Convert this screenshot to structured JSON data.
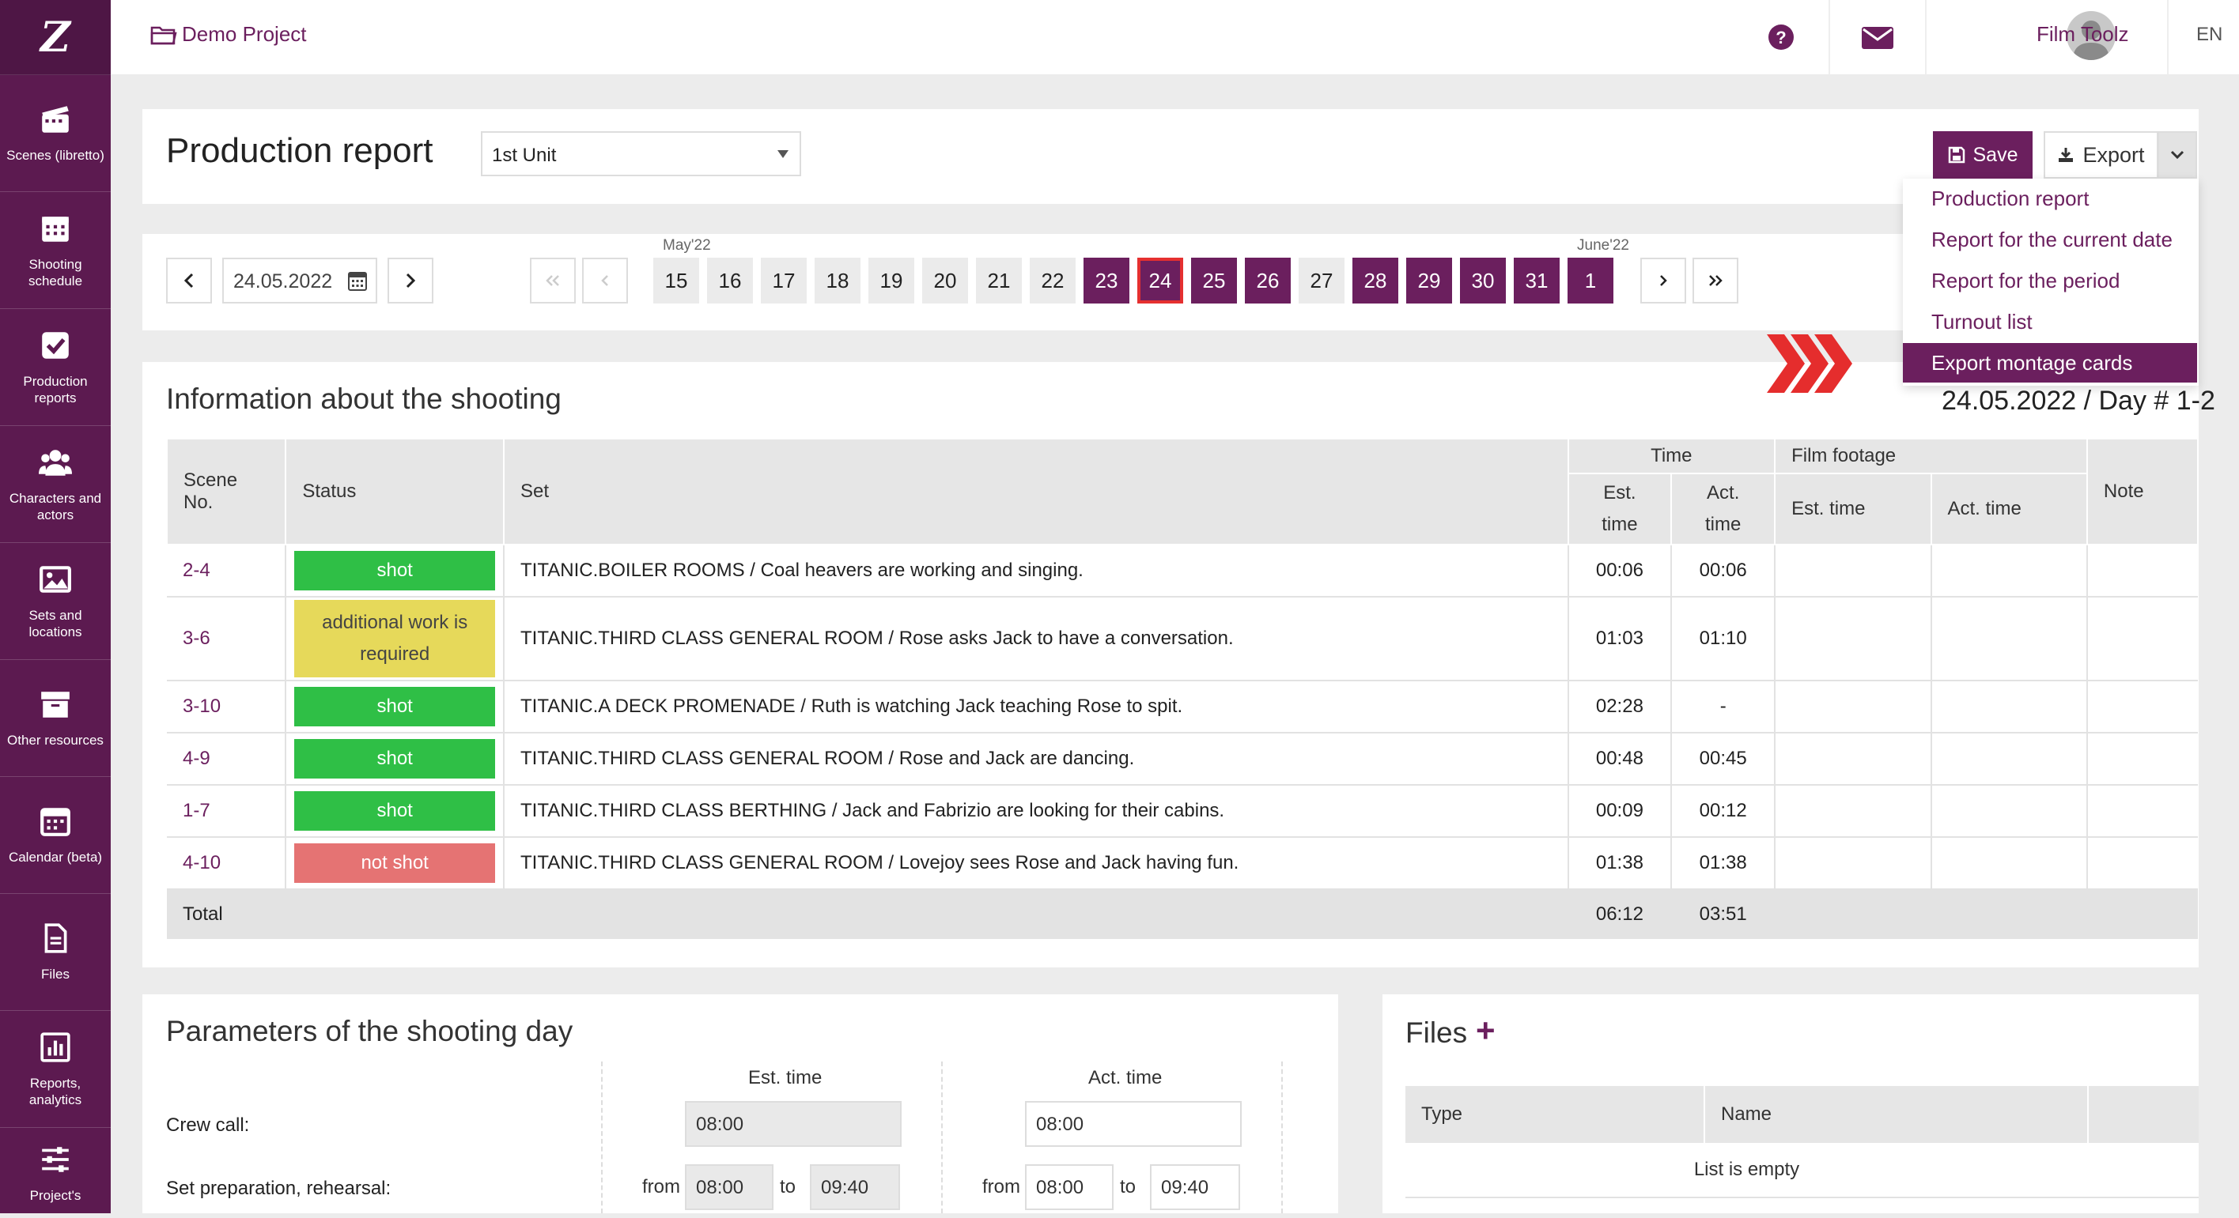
{
  "colors": {
    "brand": "#6b1f5e",
    "shot": "#2fbf46",
    "additional": "#e6d95a",
    "not_shot": "#e57373",
    "highlight_arrows": "#e52d2d"
  },
  "sidebar": {
    "logo": "Z",
    "items": [
      {
        "label": "Scenes (libretto)",
        "icon": "clapperboard-icon"
      },
      {
        "label": "Shooting schedule",
        "icon": "calendar-grid-icon"
      },
      {
        "label": "Production reports",
        "icon": "checkbox-icon"
      },
      {
        "label": "Characters and actors",
        "icon": "people-icon"
      },
      {
        "label": "Sets and locations",
        "icon": "image-icon"
      },
      {
        "label": "Other resources",
        "icon": "archive-icon"
      },
      {
        "label": "Calendar (beta)",
        "icon": "calendar-icon"
      },
      {
        "label": "Files",
        "icon": "file-icon"
      },
      {
        "label": "Reports, analytics",
        "icon": "chart-icon"
      },
      {
        "label": "Project's",
        "icon": "sliders-icon"
      }
    ]
  },
  "topbar": {
    "project": "Demo Project",
    "user": "Film Toolz",
    "lang": "EN"
  },
  "header": {
    "title": "Production report",
    "unit": "1st Unit",
    "save": "Save",
    "export": "Export"
  },
  "export_menu": [
    "Production report",
    "Report for the current date",
    "Report for the period",
    "Turnout list",
    "Export montage cards"
  ],
  "datebar": {
    "date": "24.05.2022",
    "month1": "May'22",
    "month2": "June'22",
    "days": [
      "15",
      "16",
      "17",
      "18",
      "19",
      "20",
      "21",
      "22",
      "23",
      "24",
      "25",
      "26",
      "27",
      "28",
      "29",
      "30",
      "31",
      "1"
    ]
  },
  "info": {
    "title": "Information about the shooting",
    "day_label": "24.05.2022 / Day # 1-2",
    "headers": {
      "scene": "Scene No.",
      "status": "Status",
      "set": "Set",
      "time": "Time",
      "est": "Est. time",
      "act": "Act. time",
      "footage": "Film footage",
      "f_est": "Est. time",
      "f_act": "Act. time",
      "note": "Note"
    },
    "rows": [
      {
        "scene": "2-4",
        "status": "shot",
        "set": "TITANIC.BOILER ROOMS / Coal heavers are working and singing.",
        "est": "00:06",
        "act": "00:06"
      },
      {
        "scene": "3-6",
        "status": "additional work is required",
        "set": "TITANIC.THIRD CLASS GENERAL ROOM / Rose asks Jack to have a conversation.",
        "est": "01:03",
        "act": "01:10"
      },
      {
        "scene": "3-10",
        "status": "shot",
        "set": "TITANIC.A DECK PROMENADE / Ruth is watching Jack teaching Rose to spit.",
        "est": "02:28",
        "act": "-"
      },
      {
        "scene": "4-9",
        "status": "shot",
        "set": "TITANIC.THIRD CLASS GENERAL ROOM / Rose and Jack are dancing.",
        "est": "00:48",
        "act": "00:45"
      },
      {
        "scene": "1-7",
        "status": "shot",
        "set": "TITANIC.THIRD CLASS BERTHING / Jack and Fabrizio are looking for their cabins.",
        "est": "00:09",
        "act": "00:12"
      },
      {
        "scene": "4-10",
        "status": "not shot",
        "set": "TITANIC.THIRD CLASS GENERAL ROOM / Lovejoy sees Rose and Jack having fun.",
        "est": "01:38",
        "act": "01:38"
      }
    ],
    "total": {
      "label": "Total",
      "est": "06:12",
      "act": "03:51"
    }
  },
  "params": {
    "title": "Parameters of the shooting day",
    "est_head": "Est. time",
    "act_head": "Act. time",
    "crew_call": "Crew call:",
    "set_prep": "Set preparation, rehearsal:",
    "est_crew": "08:00",
    "act_crew": "08:00",
    "from": "from",
    "to": "to",
    "est_from": "08:00",
    "est_to": "09:40",
    "act_from": "08:00",
    "act_to": "09:40"
  },
  "files": {
    "title": "Files",
    "plus": "+",
    "type": "Type",
    "name": "Name",
    "empty": "List is empty"
  }
}
